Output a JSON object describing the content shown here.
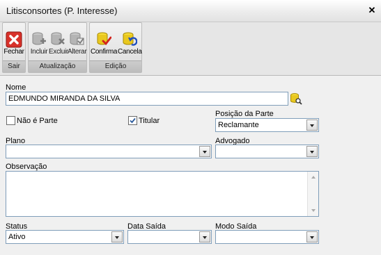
{
  "window": {
    "title": "Litisconsortes (P. Interesse)",
    "close_glyph": "✕"
  },
  "ribbon": {
    "groups": [
      {
        "label": "Sair",
        "buttons": [
          {
            "label": "Fechar",
            "icon": "close-red-x-icon"
          }
        ]
      },
      {
        "label": "Atualização",
        "buttons": [
          {
            "label": "Incluir",
            "icon": "database-add-icon"
          },
          {
            "label": "Excluir",
            "icon": "database-delete-icon"
          },
          {
            "label": "Alterar",
            "icon": "database-edit-icon"
          }
        ]
      },
      {
        "label": "Edição",
        "buttons": [
          {
            "label": "Confirma",
            "icon": "database-confirm-icon"
          },
          {
            "label": "Cancela",
            "icon": "database-cancel-icon"
          }
        ]
      }
    ]
  },
  "form": {
    "nome_label": "Nome",
    "nome_value": "EDMUNDO MIRANDA DA SILVA",
    "nao_e_parte_label": "Não é Parte",
    "nao_e_parte_checked": false,
    "titular_label": "Titular",
    "titular_checked": true,
    "posicao_label": "Posição da Parte",
    "posicao_value": "Reclamante",
    "plano_label": "Plano",
    "plano_value": "",
    "advogado_label": "Advogado",
    "advogado_value": "",
    "observacao_label": "Observação",
    "observacao_value": "",
    "status_label": "Status",
    "status_value": "Ativo",
    "data_saida_label": "Data Saída",
    "data_saida_value": "",
    "modo_saida_label": "Modo Saída",
    "modo_saida_value": ""
  }
}
